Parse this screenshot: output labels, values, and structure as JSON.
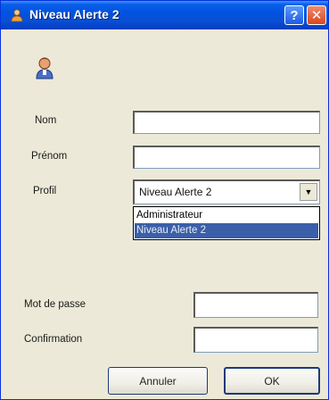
{
  "window": {
    "title": "Niveau Alerte 2",
    "title_icon": "user-icon",
    "help_label": "?",
    "close_label": "✕"
  },
  "form": {
    "nom_label": "Nom",
    "nom_value": "",
    "prenom_label": "Prénom",
    "prenom_value": "",
    "profil_label": "Profil",
    "profil_selected": "Niveau Alerte 2",
    "profil_options": [
      "Administrateur",
      "Niveau Alerte 2"
    ],
    "password_label": "Mot de passe",
    "password_value": "",
    "confirm_label": "Confirmation",
    "confirm_value": ""
  },
  "buttons": {
    "cancel": "Annuler",
    "ok": "OK"
  },
  "colors": {
    "titlebar": "#0053e1",
    "selection": "#3b5fa8",
    "dialog_bg": "#ece9d8"
  }
}
